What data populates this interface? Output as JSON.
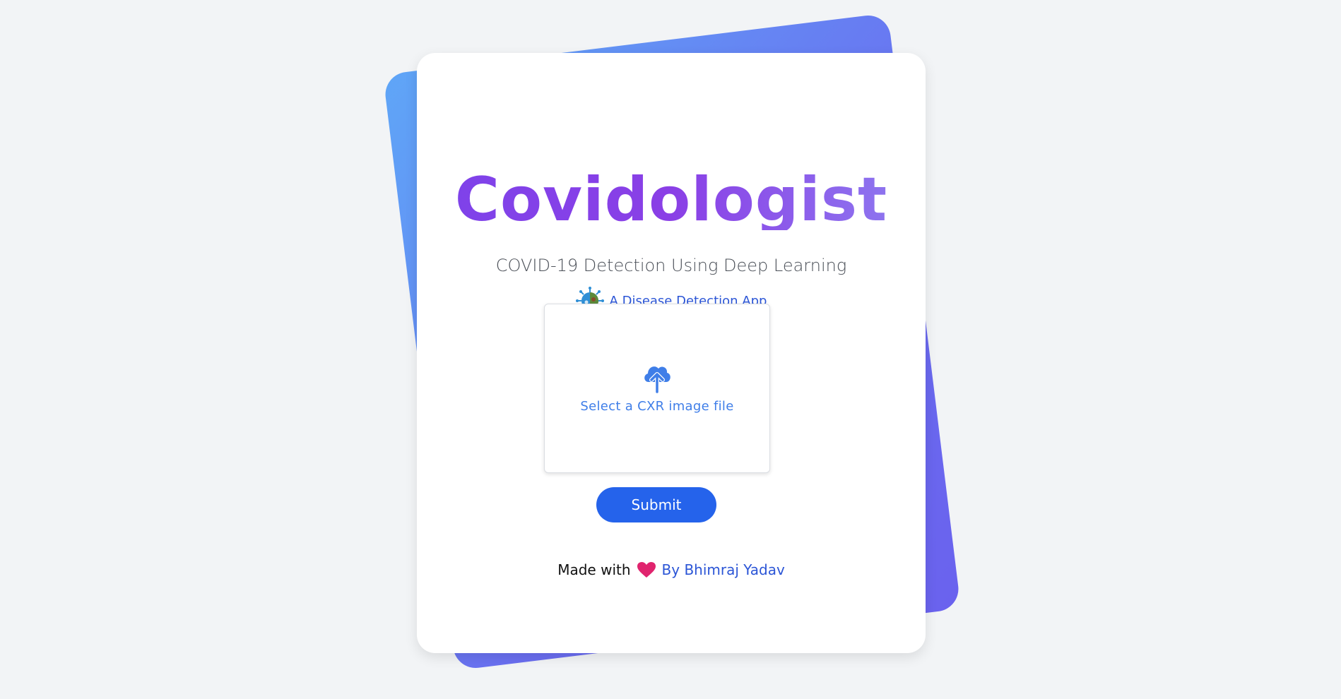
{
  "app": {
    "title": "Covidologist",
    "subtitle": "COVID-19 Detection Using Deep Learning",
    "tagline": "A Disease Detection App"
  },
  "upload": {
    "label": "Select a CXR image file",
    "icon": "cloud-upload-icon"
  },
  "form": {
    "submit_label": "Submit"
  },
  "footer": {
    "made_with": "Made with",
    "author": "By Bhimraj Yadav",
    "heart_icon": "heart-icon"
  },
  "colors": {
    "background": "#f2f4f6",
    "accent_blue": "#2563eb",
    "title_purple": "#7d43ea",
    "link_blue": "#2b55d6",
    "heart": "#e0246e",
    "back_card_start": "#5fa6f7",
    "back_card_end": "#6a62ee"
  }
}
